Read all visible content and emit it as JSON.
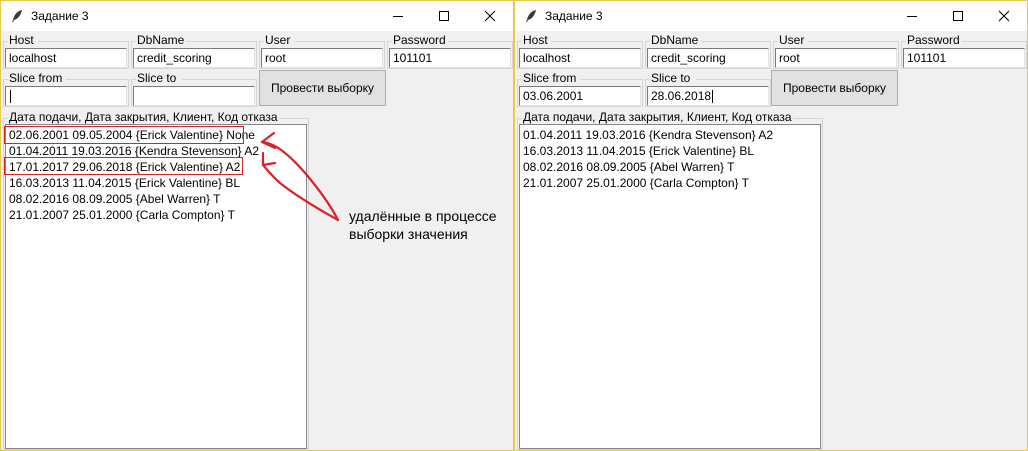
{
  "window_title": "Задание 3",
  "fields": {
    "host_label": "Host",
    "dbname_label": "DbName",
    "user_label": "User",
    "password_label": "Password",
    "slice_from_label": "Slice from",
    "slice_to_label": "Slice to",
    "host_value": "localhost",
    "dbname_value": "credit_scoring",
    "user_value": "root",
    "password_value": "101101"
  },
  "button_label": "Провести выборку",
  "list_header": "Дата подачи, Дата закрытия, Клиент, Код отказа",
  "left": {
    "slice_from": "",
    "slice_to": "",
    "rows": [
      "02.06.2001 09.05.2004 {Erick Valentine} None",
      "01.04.2011 19.03.2016 {Kendra Stevenson} A2",
      "17.01.2017 29.06.2018 {Erick Valentine} A2",
      "16.03.2013 11.04.2015 {Erick Valentine} BL",
      "08.02.2016 08.09.2005 {Abel Warren} T",
      "21.01.2007 25.01.2000 {Carla Compton} T"
    ]
  },
  "right": {
    "slice_from": "03.06.2001",
    "slice_to": "28.06.2018",
    "rows": [
      "01.04.2011 19.03.2016 {Kendra Stevenson} A2",
      "16.03.2013 11.04.2015 {Erick Valentine} BL",
      "08.02.2016 08.09.2005 {Abel Warren} T",
      "21.01.2007 25.01.2000 {Carla Compton} T"
    ]
  },
  "annotation": {
    "line1": "удалённые в процессе",
    "line2": "выборки значения",
    "color": "#d9222a"
  }
}
